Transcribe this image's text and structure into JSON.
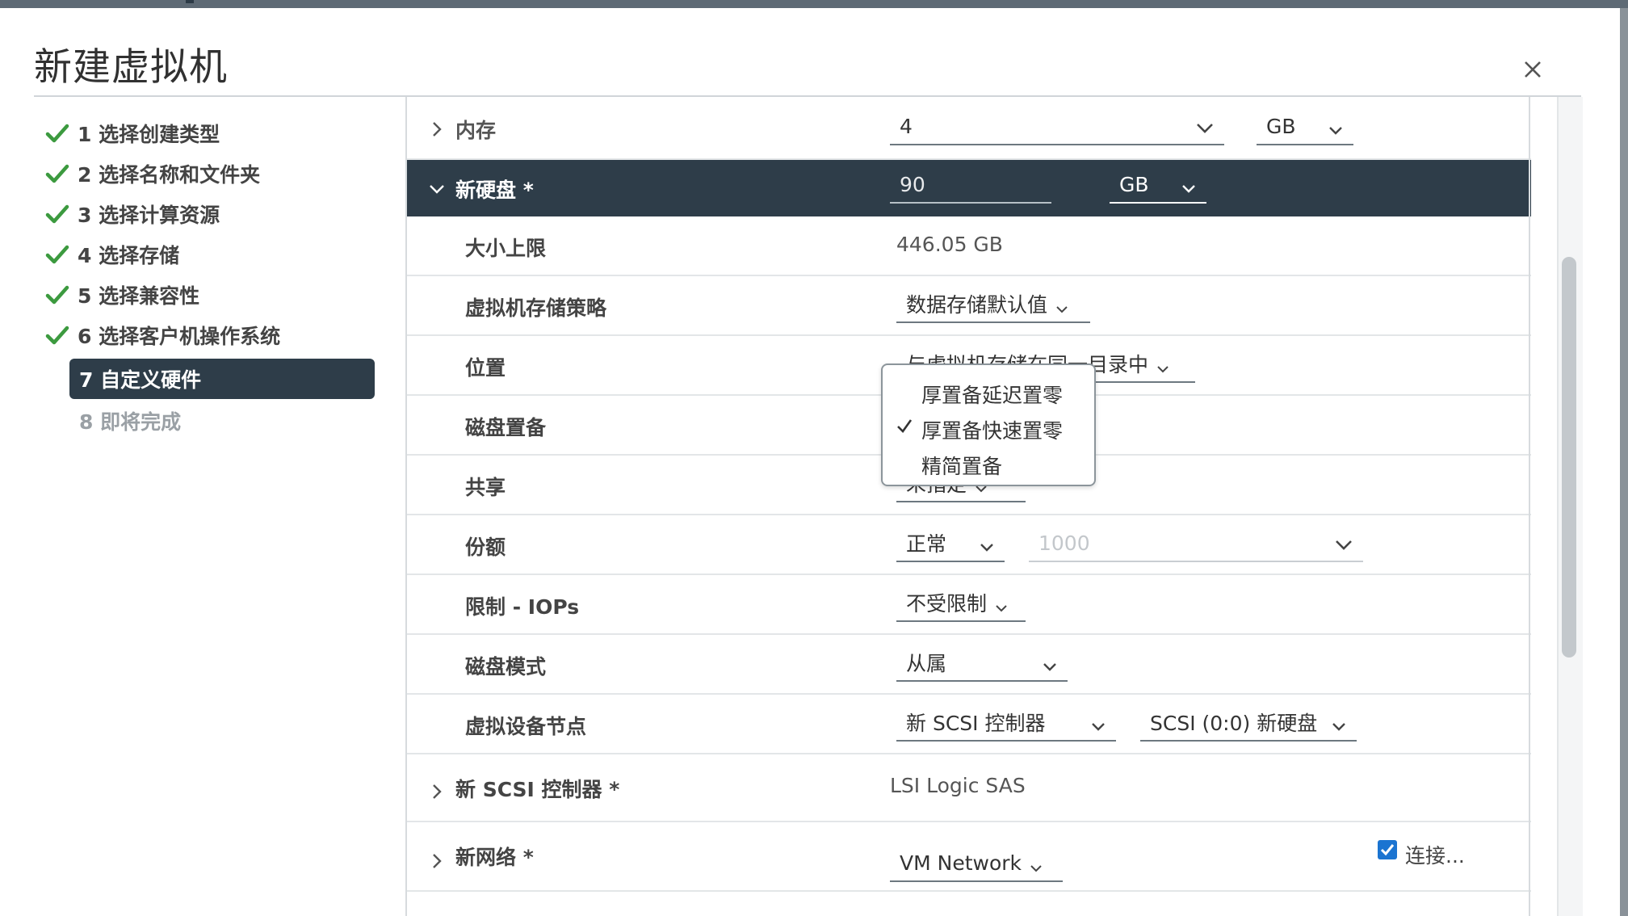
{
  "dialog": {
    "title": "新建虚拟机",
    "close_icon": "close-icon"
  },
  "steps": [
    {
      "label": "1 选择创建类型",
      "done": true
    },
    {
      "label": "2 选择名称和文件夹",
      "done": true
    },
    {
      "label": "3 选择计算资源",
      "done": true
    },
    {
      "label": "4 选择存储",
      "done": true
    },
    {
      "label": "5 选择兼容性",
      "done": true
    },
    {
      "label": "6 选择客户机操作系统",
      "done": true
    },
    {
      "label": "7 自定义硬件",
      "active": true
    },
    {
      "label": "8 即将完成",
      "disabled": true
    }
  ],
  "memory": {
    "label": "内存",
    "value": "4",
    "unit": "GB"
  },
  "new_disk": {
    "label": "新硬盘 *",
    "value": "90",
    "unit": "GB",
    "max_size": {
      "label": "大小上限",
      "value": "446.05 GB"
    },
    "storage_policy": {
      "label": "虚拟机存储策略",
      "value": "数据存储默认值"
    },
    "location": {
      "label": "位置",
      "value_visible": "与虚拟机存储在同一目录中",
      "value_tail": "目录中"
    },
    "provisioning": {
      "label": "磁盘置备",
      "options": [
        "厚置备延迟置零",
        "厚置备快速置零",
        "精简置备"
      ],
      "selected": "厚置备快速置零"
    },
    "sharing": {
      "label": "共享",
      "value": "未指定"
    },
    "shares": {
      "label": "份额",
      "value": "正常",
      "amount_placeholder": "1000"
    },
    "limit_iops": {
      "label": "限制 - IOPs",
      "value": "不受限制"
    },
    "disk_mode": {
      "label": "磁盘模式",
      "value": "从属"
    },
    "vdev_node": {
      "label": "虚拟设备节点",
      "controller": "新 SCSI 控制器",
      "node": "SCSI (0:0) 新硬盘"
    }
  },
  "scsi_controller": {
    "label": "新 SCSI 控制器 *",
    "value": "LSI Logic SAS"
  },
  "network": {
    "label": "新网络 *",
    "value": "VM Network",
    "connect_label": "连接..."
  },
  "colors": {
    "accent": "#2e3d49",
    "check_green": "#3c9a3f",
    "checkbox_blue": "#1b74d1"
  }
}
